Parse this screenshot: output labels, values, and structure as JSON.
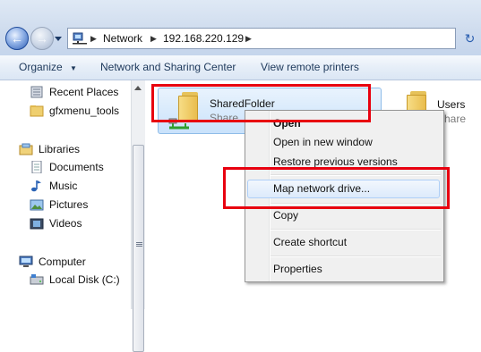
{
  "address": {
    "crumbs": [
      "Network",
      "192.168.220.129"
    ]
  },
  "toolbar": {
    "organize_label": "Organize",
    "network_sharing_label": "Network and Sharing Center",
    "view_printers_label": "View remote printers"
  },
  "nav": {
    "recent_places": "Recent Places",
    "gfxmenu_tools": "gfxmenu_tools",
    "libraries": "Libraries",
    "documents": "Documents",
    "music": "Music",
    "pictures": "Pictures",
    "videos": "Videos",
    "computer": "Computer",
    "local_disk": "Local Disk (C:)"
  },
  "content": {
    "shared_folder": {
      "name": "SharedFolder",
      "subtitle": "Share"
    },
    "users_folder": {
      "name": "Users",
      "subtitle": "Share"
    }
  },
  "context_menu": {
    "open": "Open",
    "open_new_window": "Open in new window",
    "restore_versions": "Restore previous versions",
    "map_drive": "Map network drive...",
    "copy": "Copy",
    "create_shortcut": "Create shortcut",
    "properties": "Properties"
  },
  "colors": {
    "highlight_box": "#e8000f",
    "selection": "#cce4fb"
  }
}
